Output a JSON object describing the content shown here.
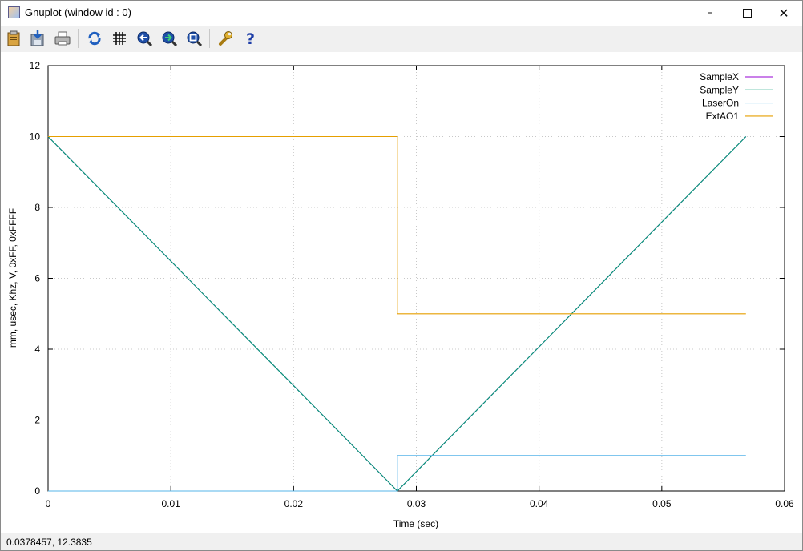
{
  "window": {
    "title": "Gnuplot (window id : 0)"
  },
  "toolbar": {
    "buttons": [
      {
        "name": "copy-clipboard-button",
        "icon": "clipboard-icon"
      },
      {
        "name": "save-button",
        "icon": "save-icon"
      },
      {
        "name": "print-button",
        "icon": "printer-icon"
      },
      {
        "name": "replot-button",
        "icon": "refresh-icon"
      },
      {
        "name": "grid-button",
        "icon": "grid-icon"
      },
      {
        "name": "zoom-previous-button",
        "icon": "zoom-back-icon"
      },
      {
        "name": "zoom-next-button",
        "icon": "zoom-forward-icon"
      },
      {
        "name": "autoscale-button",
        "icon": "zoom-fit-icon"
      },
      {
        "name": "options-button",
        "icon": "wrench-icon"
      },
      {
        "name": "help-button",
        "icon": "help-icon"
      }
    ]
  },
  "status": {
    "text": "0.0378457,  12.3835"
  },
  "chart_data": {
    "type": "line",
    "xlabel": "Time (sec)",
    "ylabel": "mm, usec, Khz, V, 0xFF, 0xFFFF",
    "xlim": [
      0,
      0.06
    ],
    "ylim": [
      0,
      12
    ],
    "xticks": [
      "0",
      "0.01",
      "0.02",
      "0.03",
      "0.04",
      "0.05",
      "0.06"
    ],
    "yticks": [
      "0",
      "2",
      "4",
      "6",
      "8",
      "10",
      "12"
    ],
    "grid": true,
    "legend_position": "top-right",
    "series": [
      {
        "name": "SampleX",
        "color": "#9400d3",
        "x": [
          0,
          0.02845,
          0.05685
        ],
        "y": [
          10,
          0,
          10
        ]
      },
      {
        "name": "SampleY",
        "color": "#009e73",
        "x": [
          0,
          0.02845,
          0.05685
        ],
        "y": [
          10,
          0,
          10
        ]
      },
      {
        "name": "LaserOn",
        "color": "#56b4e9",
        "x": [
          0,
          0.02845,
          0.02845,
          0.05685
        ],
        "y": [
          0,
          0,
          1,
          1
        ]
      },
      {
        "name": "ExtAO1",
        "color": "#e69f00",
        "x": [
          0,
          0.02845,
          0.02845,
          0.05685
        ],
        "y": [
          10,
          10,
          5,
          5
        ]
      }
    ]
  }
}
